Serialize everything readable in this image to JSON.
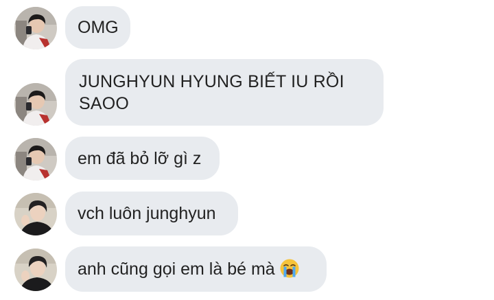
{
  "messages": [
    {
      "text": "OMG",
      "avatar": "avatar-a"
    },
    {
      "text": "JUNGHYUN HYUNG BIẾT IU RỒI SAOO",
      "avatar": "avatar-a"
    },
    {
      "text": "em đã bỏ lỡ gì z",
      "avatar": "avatar-a"
    },
    {
      "text": "vch luôn junghyun",
      "avatar": "avatar-b"
    },
    {
      "text": "anh cũng gọi em là bé mà",
      "avatar": "avatar-b",
      "emoji": "loudly-crying-face-icon"
    }
  ],
  "colors": {
    "bubble": "#e8ebef",
    "text": "#222222",
    "background": "#ffffff"
  }
}
